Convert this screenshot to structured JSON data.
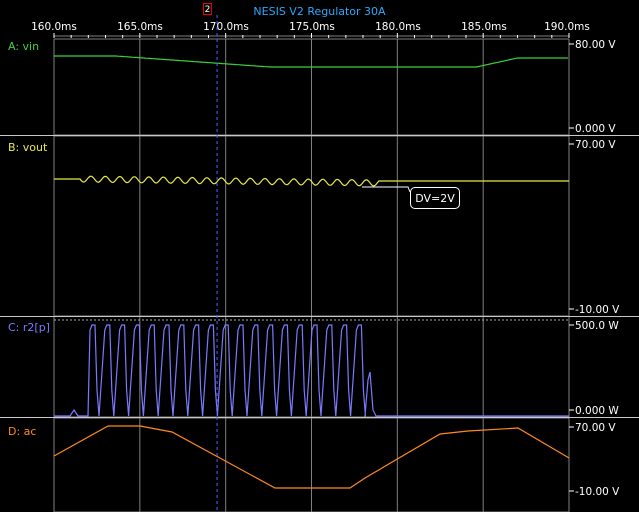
{
  "window": {
    "title": "NESIS V2 Regulator 30A"
  },
  "cursor": {
    "label": "2",
    "time_ms": 169.5
  },
  "time_axis": {
    "unit": "ms",
    "ticks": [
      "160.0ms",
      "165.0ms",
      "170.0ms",
      "175.0ms",
      "180.0ms",
      "185.0ms",
      "190.0ms"
    ],
    "range": [
      160.0,
      190.0
    ]
  },
  "channels": [
    {
      "id": "A",
      "label": "A: vin",
      "color": "#3ad43a",
      "max_label": "80.00 V",
      "min_label": "0.000 V"
    },
    {
      "id": "B",
      "label": "B: vout",
      "color": "#e8e84a",
      "max_label": "70.00 V",
      "min_label": "-10.00 V"
    },
    {
      "id": "C",
      "label": "C: r2[p]",
      "color": "#7a7aff",
      "max_label": "500.0 W",
      "min_label": "0.000 W"
    },
    {
      "id": "D",
      "label": "D: ac",
      "color": "#ff8a1e",
      "max_label": "70.00 V",
      "min_label": "-10.00 V"
    }
  ],
  "annotation": {
    "text": "DV=2V"
  },
  "colors": {
    "title": "#2aa8ff",
    "grid": "#808080",
    "background": "#000000",
    "cursor": "#5a5aff"
  }
}
